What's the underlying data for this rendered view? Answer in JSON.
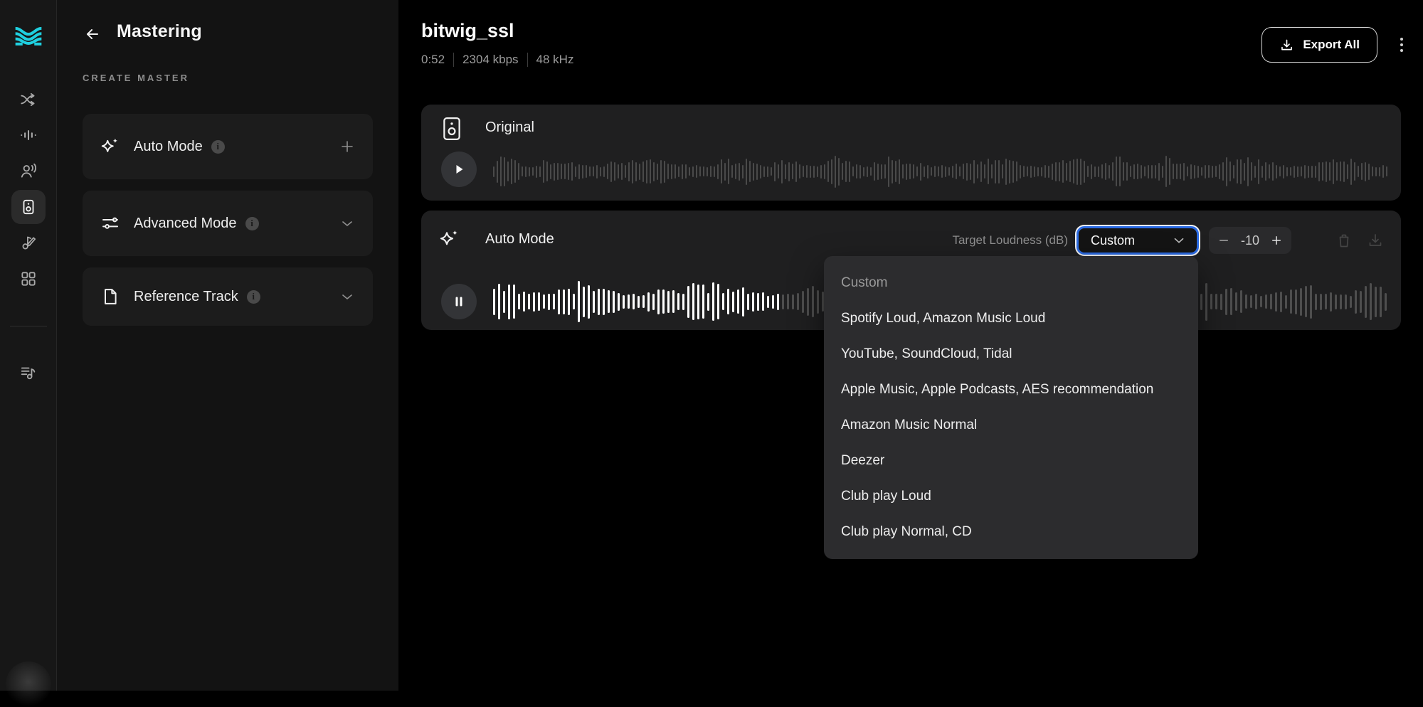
{
  "sidebar": {
    "icons": [
      "split-tracks-icon",
      "waveform-icon",
      "voice-studio-icon",
      "mastering-speaker-icon",
      "songwriting-icon",
      "apps-grid-icon",
      "playlist-icon"
    ],
    "active_icon": "mastering-speaker-icon"
  },
  "panel": {
    "title": "Mastering",
    "section_label": "CREATE MASTER",
    "cards": [
      {
        "label": "Auto Mode",
        "action": "add"
      },
      {
        "label": "Advanced Mode",
        "action": "expand"
      },
      {
        "label": "Reference Track",
        "action": "expand"
      }
    ]
  },
  "header": {
    "title": "bitwig_ssl",
    "duration": "0:52",
    "bitrate": "2304 kbps",
    "sample_rate": "48 kHz",
    "export_label": "Export All"
  },
  "original_track": {
    "label": "Original"
  },
  "auto_mode": {
    "label": "Auto Mode",
    "loudness_label": "Target Loudness (dB)",
    "preset_value": "Custom",
    "loudness_value": "-10"
  },
  "dropdown": {
    "selected": "Custom",
    "options": [
      "Custom",
      "Spotify Loud, Amazon Music Loud",
      "YouTube, SoundCloud, Tidal",
      "Apple Music, Apple Podcasts, AES recommendation",
      "Amazon Music Normal",
      "Deezer",
      "Club play Loud",
      "Club play Normal, CD"
    ]
  },
  "colors": {
    "accent_teal": "#1fd0e0",
    "accent_blue": "#2b6be4",
    "card_bg": "#1f1f20",
    "dropdown_bg": "#2c2c2e"
  }
}
